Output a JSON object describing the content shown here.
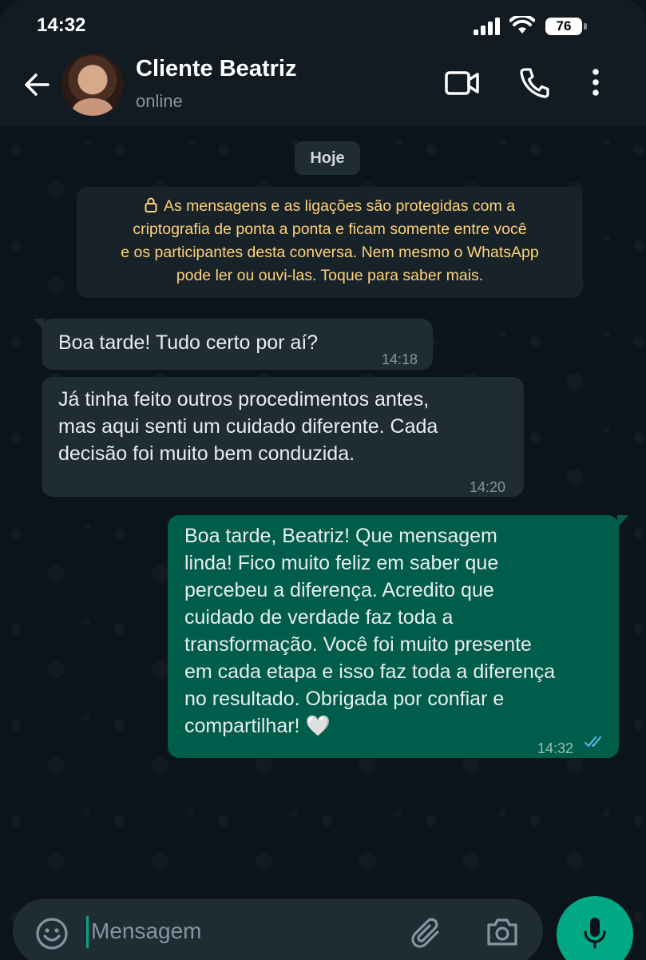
{
  "status_bar": {
    "time": "14:32",
    "battery": "76"
  },
  "header": {
    "contact_name": "Cliente Beatriz",
    "contact_status": "online",
    "icons": [
      "back-arrow-icon",
      "video-call-icon",
      "voice-call-icon",
      "more-options-icon"
    ]
  },
  "chat": {
    "day_label": "Hoje",
    "encryption_notice": {
      "lines": [
        "As mensagens e as ligações são protegidas com a",
        "criptografia de ponta a ponta e ficam somente entre você",
        "e os participantes desta conversa. Nem mesmo o WhatsApp",
        "pode ler ou ouvi-las. Toque para saber mais."
      ]
    },
    "messages": [
      {
        "direction": "in",
        "lines": [
          "Boa tarde! Tudo certo por aí?"
        ],
        "time": "14:18"
      },
      {
        "direction": "in",
        "lines": [
          "Já tinha feito outros procedimentos antes,",
          "mas aqui senti um cuidado diferente. Cada",
          "decisão foi muito bem conduzida."
        ],
        "time": "14:20"
      },
      {
        "direction": "out",
        "lines": [
          "Boa tarde, Beatriz! Que mensagem",
          "linda! Fico muito feliz em saber que",
          "percebeu a diferença. Acredito que",
          "cuidado de verdade faz toda a",
          "transformação. Você foi muito presente",
          "em cada etapa e isso faz toda a diferença",
          "no resultado. Obrigada por confiar e",
          "compartilhar! 🤍"
        ],
        "time": "14:32",
        "read": true
      }
    ]
  },
  "composer": {
    "placeholder": "Mensagem",
    "icons": [
      "emoji-icon",
      "attach-icon",
      "camera-icon",
      "microphone-icon"
    ]
  },
  "colors": {
    "background": "#0b141a",
    "header": "#111b21",
    "incoming_bubble": "#202c33",
    "outgoing_bubble": "#005c4b",
    "accent": "#00a884",
    "notice_text": "#ffd279",
    "read_ticks": "#53bdeb"
  }
}
